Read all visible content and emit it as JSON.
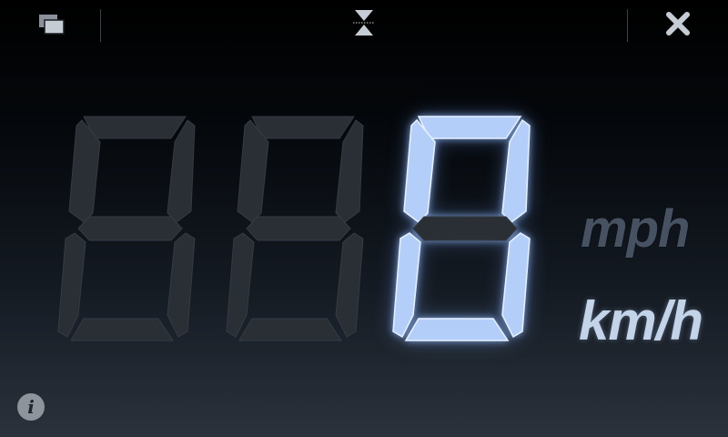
{
  "toolbar": {
    "window_icon": "windows-stack-icon",
    "hourglass_icon": "hourglass-icon",
    "close_icon": "close-x-icon",
    "info_label": "i"
  },
  "display": {
    "digits": [
      {
        "value": "",
        "lit": false
      },
      {
        "value": "",
        "lit": false
      },
      {
        "value": "0",
        "lit": true
      }
    ]
  },
  "units": {
    "mph": "mph",
    "kmh": "km/h",
    "active": "km/h"
  },
  "colors": {
    "lit_segment": "#b3cff9",
    "unlit_segment": "#2a2f36",
    "active_unit": "#c3d3e8",
    "inactive_unit": "#465261"
  }
}
